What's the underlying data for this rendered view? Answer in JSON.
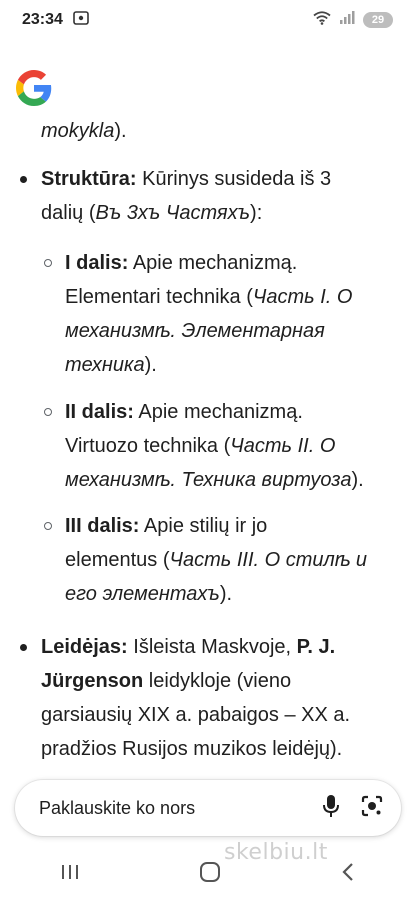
{
  "status_bar": {
    "time": "23:34",
    "battery": "29",
    "icons": [
      "screenshot-icon",
      "wifi-icon",
      "signal-icon",
      "battery-icon"
    ]
  },
  "content": {
    "intro_tail": "mokykla",
    "intro_tail_after": ").",
    "structure": {
      "label": "Struktūra:",
      "text1": " Kūrinys susideda iš 3",
      "text2a": "dalių (",
      "text2_italic": "Въ 3хъ Частяхъ",
      "text2b": "):"
    },
    "parts": [
      {
        "label": "I dalis:",
        "l1": " Apie mechanizmą.",
        "l2a": "Elementari technika (",
        "l2_italic": "Часть I. О",
        "l3_italic": "механизмѣ. Элементарная",
        "l4_italic": "техника",
        "l4b": ")."
      },
      {
        "label": "II dalis:",
        "l1": " Apie mechanizmą.",
        "l2a": "Virtuozo technika (",
        "l2_italic": "Часть II. О",
        "l3_italic": "механизмѣ. Техника виртуоза",
        "l3b": ")."
      },
      {
        "label": "III dalis:",
        "l1": " Apie stilių ir jo",
        "l2a": "elementus (",
        "l2_italic": "Часть III. О стилѣ и",
        "l3_italic": "его элементахъ",
        "l3b": ")."
      }
    ],
    "publisher": {
      "label": "Leidėjas:",
      "l1a": " Išleista Maskvoje, ",
      "l1_bold": "P. J.",
      "l2_bold": "Jürgenson",
      "l2b": " leidykloje (vieno",
      "l3": "garsiausių XIX a. pabaigos – XX a.",
      "l4": "pradžios Rusijos muzikos leidėjų)."
    }
  },
  "ask_bar": {
    "placeholder": "Paklauskite ko nors"
  },
  "watermark": "skelbiu.lt",
  "colors": {
    "google_blue": "#4285F4",
    "google_red": "#EA4335",
    "google_yellow": "#FBBC05",
    "google_green": "#34A853"
  }
}
